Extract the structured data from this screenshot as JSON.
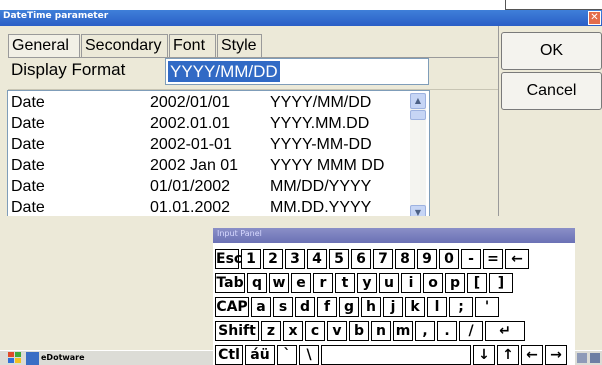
{
  "dialog": {
    "title": "DateTime parameter",
    "close_glyph": "✕",
    "tabs": [
      "General",
      "Secondary",
      "Font",
      "Style"
    ],
    "display_format_label": "Display Format",
    "display_format_value": "YYYY/MM/DD",
    "ok_label": "OK",
    "cancel_label": "Cancel",
    "rows": [
      [
        "Date",
        "2002/01/01",
        "YYYY/MM/DD"
      ],
      [
        "Date",
        "2002.01.01",
        "YYYY.MM.DD"
      ],
      [
        "Date",
        "2002-01-01",
        "YYYY-MM-DD"
      ],
      [
        "Date",
        "2002 Jan 01",
        "YYYY MMM DD"
      ],
      [
        "Date",
        "01/01/2002",
        "MM/DD/YYYY"
      ],
      [
        "Date",
        "01.01.2002",
        "MM.DD.YYYY"
      ]
    ]
  },
  "input_panel": {
    "title": "Input Panel",
    "rows": [
      [
        "Esc",
        "1",
        "2",
        "3",
        "4",
        "5",
        "6",
        "7",
        "8",
        "9",
        "0",
        "-",
        "=",
        "←"
      ],
      [
        "Tab",
        "q",
        "w",
        "e",
        "r",
        "t",
        "y",
        "u",
        "i",
        "o",
        "p",
        "[",
        "]"
      ],
      [
        "CAP",
        "a",
        "s",
        "d",
        "f",
        "g",
        "h",
        "j",
        "k",
        "l",
        ";",
        "'"
      ],
      [
        "Shift",
        "z",
        "x",
        "c",
        "v",
        "b",
        "n",
        "m",
        ",",
        ".",
        "/",
        "↵"
      ],
      [
        "Ctl",
        "áü",
        "`",
        "\\",
        " ",
        "↓",
        "↑",
        "←",
        "→"
      ]
    ]
  },
  "taskbar": {
    "app_label": "eDotware"
  },
  "colors": {
    "title_blue": "#2a5ec6",
    "selection": "#316ac5",
    "dialog_bg": "#ece9d8",
    "panel_title": "#6b71b5"
  }
}
